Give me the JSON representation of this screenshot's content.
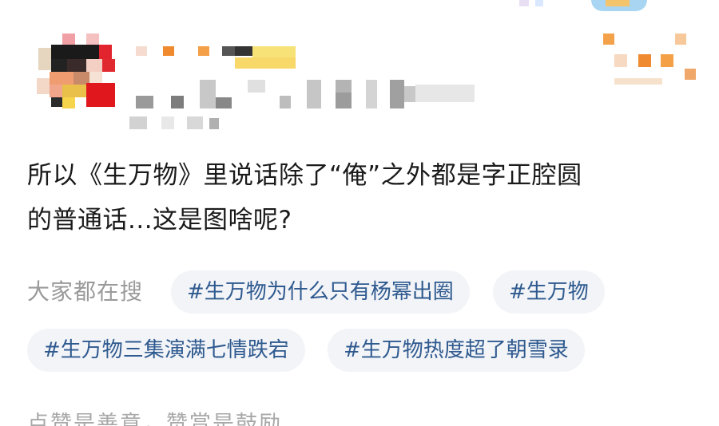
{
  "post": {
    "text_line1": "所以《生万物》里说话除了“俺”之外都是字正腔圆",
    "text_line2": "的普通话...这是图啥呢?"
  },
  "search": {
    "label": "大家都在搜",
    "tags": [
      "#生万物为什么只有杨幂出圈",
      "#生万物",
      "#生万物三集演满七情跌宕",
      "#生万物热度超了朝雪录"
    ]
  },
  "footer": {
    "text": "点赞是善意，赞赏是鼓励"
  },
  "colors": {
    "tag_text": "#2f5a8f",
    "tag_bg": "#f2f4f8",
    "muted_text": "#9a9a9a",
    "body_text": "#1a1a1a"
  }
}
